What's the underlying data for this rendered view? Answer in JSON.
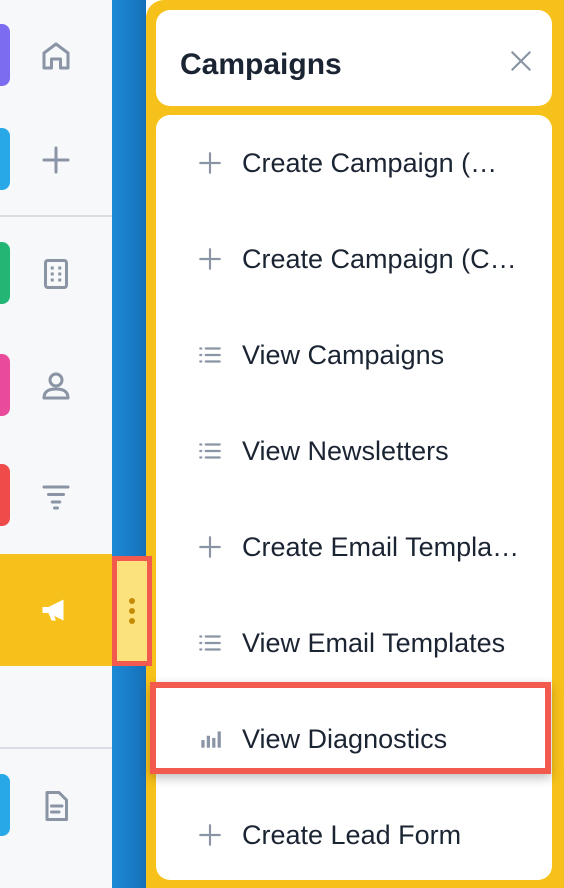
{
  "rail": {
    "items": [
      {
        "name": "home-icon",
        "accent": "#7b6cf0"
      },
      {
        "name": "plus-icon",
        "accent": "#29a8e8"
      },
      {
        "name": "building-icon",
        "accent": "#22b573"
      },
      {
        "name": "user-icon",
        "accent": "#e94b9a"
      },
      {
        "name": "filter-icon",
        "accent": "#ef4b4b"
      },
      {
        "name": "megaphone-icon",
        "accent": "#f7c11b"
      },
      {
        "name": "document-icon",
        "accent": "#29a8e8"
      }
    ]
  },
  "panel": {
    "title": "Campaigns",
    "close_icon": "close-icon",
    "items": [
      {
        "label": "Create Campaign (…",
        "icon": "plus-icon"
      },
      {
        "label": "Create Campaign (C…",
        "icon": "plus-icon"
      },
      {
        "label": "View Campaigns",
        "icon": "list-icon"
      },
      {
        "label": "View Newsletters",
        "icon": "list-icon"
      },
      {
        "label": "Create Email Templa…",
        "icon": "plus-icon"
      },
      {
        "label": "View Email Templates",
        "icon": "list-icon"
      },
      {
        "label": "View Diagnostics",
        "icon": "bar-chart-icon"
      },
      {
        "label": "Create Lead Form",
        "icon": "plus-icon"
      }
    ]
  },
  "colors": {
    "accent_yellow": "#f7c11b",
    "highlight_red": "#f25a4d",
    "text_dark": "#1b2432",
    "icon_gray": "#8a94a4"
  }
}
